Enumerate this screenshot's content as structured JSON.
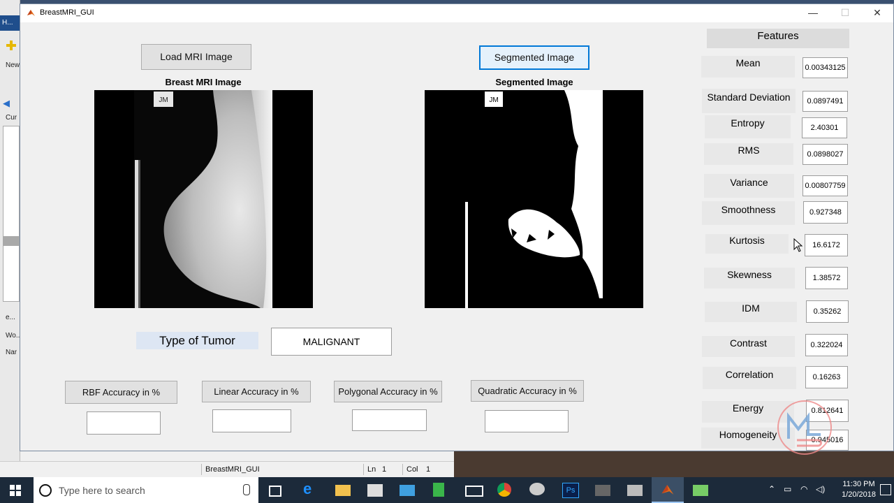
{
  "window": {
    "title": "BreastMRI_GUI",
    "minimize_glyph": "—",
    "maximize_glyph": "☐",
    "close_glyph": "✕"
  },
  "background": {
    "app_label": "H...",
    "new_label": "New",
    "cur_label": "Cur",
    "e_label": "e...",
    "wo_label": "Wo...",
    "nam_label": "Nar",
    "status_file": "BreastMRI_GUI",
    "status_ln_label": "Ln",
    "status_ln": "1",
    "status_col_label": "Col",
    "status_col": "1"
  },
  "left_panel": {
    "load_button": "Load MRI Image",
    "axis_title": "Breast MRI Image",
    "tumor_label": "Type of Tumor",
    "tumor_value": "MALIGNANT"
  },
  "center_panel": {
    "segment_button": "Segmented Image",
    "axis_title": "Segmented Image"
  },
  "accuracy": [
    {
      "label": "RBF Accuracy in %",
      "value": ""
    },
    {
      "label": "Linear Accuracy in %",
      "value": ""
    },
    {
      "label": "Polygonal Accuracy in %",
      "value": ""
    },
    {
      "label": "Quadratic Accuracy in %",
      "value": ""
    }
  ],
  "features": {
    "header": "Features",
    "items": [
      {
        "label": "Mean",
        "value": "0.00343125"
      },
      {
        "label": "Standard Deviation",
        "value": "0.0897491"
      },
      {
        "label": "Entropy",
        "value": "2.40301"
      },
      {
        "label": "RMS",
        "value": "0.0898027"
      },
      {
        "label": "Variance",
        "value": "0.00807759"
      },
      {
        "label": "Smoothness",
        "value": "0.927348"
      },
      {
        "label": "Kurtosis",
        "value": "16.6172"
      },
      {
        "label": "Skewness",
        "value": "1.38572"
      },
      {
        "label": "IDM",
        "value": "0.35262"
      },
      {
        "label": "Contrast",
        "value": "0.322024"
      },
      {
        "label": "Correlation",
        "value": "0.16263"
      },
      {
        "label": "Energy",
        "value": "0.812641"
      },
      {
        "label": "Homogeneity",
        "value": "0.945016"
      }
    ]
  },
  "image_tags": {
    "mri_tag": "JM",
    "seg_tag": "JM"
  },
  "taskbar": {
    "search_placeholder": "Type here to search",
    "time": "11:30 PM",
    "date": "1/20/2018"
  }
}
